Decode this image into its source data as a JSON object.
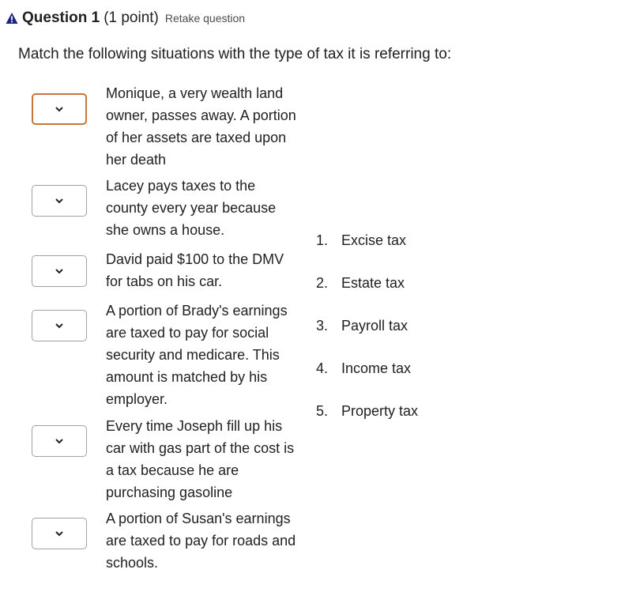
{
  "header": {
    "title": "Question 1",
    "points": "(1 point)",
    "retake": "Retake question"
  },
  "prompt": "Match the following situations with the type of tax it is referring to:",
  "situations": [
    {
      "text": "Monique, a very wealth land owner, passes away.  A portion of her assets are taxed upon her death"
    },
    {
      "text": "Lacey pays taxes to the county every year because she owns a house."
    },
    {
      "text": "David paid $100 to the DMV for tabs on his car."
    },
    {
      "text": "A portion of Brady's earnings are taxed to pay for social security and medicare.  This amount is matched by his employer."
    },
    {
      "text": "Every time Joseph fill up his car with gas part of the cost is a tax because he are purchasing gasoline"
    },
    {
      "text": "A portion of Susan's earnings are taxed to pay for roads and schools."
    }
  ],
  "choices": [
    {
      "num": "1.",
      "label": "Excise tax"
    },
    {
      "num": "2.",
      "label": "Estate tax"
    },
    {
      "num": "3.",
      "label": "Payroll tax"
    },
    {
      "num": "4.",
      "label": "Income tax"
    },
    {
      "num": "5.",
      "label": "Property tax"
    }
  ],
  "colors": {
    "warning_icon": "#1a237e",
    "focused_border": "#c8743a",
    "select_border": "#9ea2a6"
  }
}
